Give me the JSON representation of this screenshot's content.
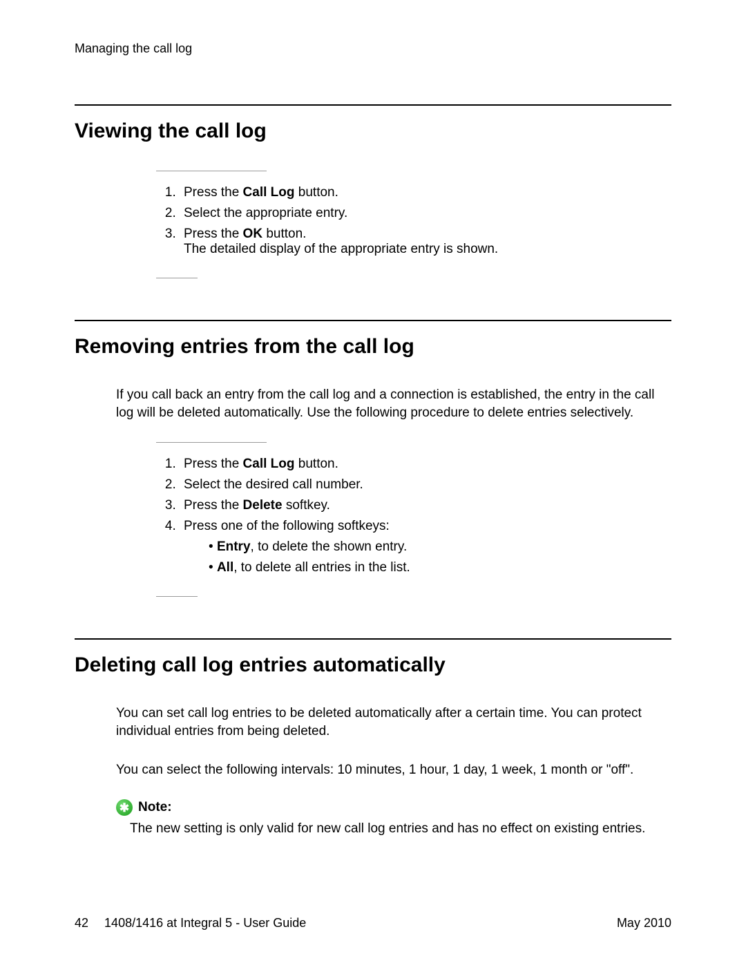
{
  "header": "Managing the call log",
  "section1": {
    "title": "Viewing the call log",
    "steps": [
      {
        "prefix": "Press the ",
        "bold": "Call Log",
        "suffix": " button."
      },
      {
        "text": "Select the appropriate entry."
      },
      {
        "prefix": "Press the ",
        "bold": "OK",
        "suffix": " button.",
        "detail": "The detailed display of the appropriate entry is shown."
      }
    ]
  },
  "section2": {
    "title": "Removing entries from the call log",
    "intro": "If you call back an entry from the call log and a connection is established, the entry in the call log will be deleted automatically. Use the following procedure to delete entries selectively.",
    "steps": [
      {
        "prefix": "Press the ",
        "bold": "Call Log",
        "suffix": " button."
      },
      {
        "text": "Select the desired call number."
      },
      {
        "prefix": "Press the ",
        "bold": "Delete",
        "suffix": " softkey."
      },
      {
        "text": "Press one of the following softkeys:",
        "subitems": [
          {
            "bold": "Entry",
            "suffix": ", to delete the shown entry."
          },
          {
            "bold": "All",
            "suffix": ", to delete all entries in the list."
          }
        ]
      }
    ]
  },
  "section3": {
    "title": "Deleting call log entries automatically",
    "para1": "You can set call log entries to be deleted automatically after a certain time. You can protect individual entries from being deleted.",
    "para2": "You can select the following intervals: 10 minutes, 1 hour, 1 day, 1 week, 1 month or \"off\".",
    "note_label": "Note:",
    "note_text": "The new setting is only valid for new call log entries and has no effect on existing entries."
  },
  "footer": {
    "page_number": "42",
    "doc_title": "1408/1416 at Integral 5 - User Guide",
    "date": "May 2010"
  }
}
